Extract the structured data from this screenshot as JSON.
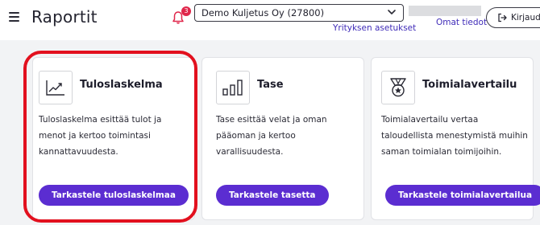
{
  "header": {
    "title": "Raportit",
    "notification_count": "3",
    "company_select_value": "Demo Kuljetus Oy (27800)",
    "company_settings_link": "Yrityksen asetukset",
    "own_info_link": "Omat tiedot",
    "logout_label": "Kirjaudu"
  },
  "cards": [
    {
      "title": "Tuloslaskelma",
      "description": "Tuloslaskelma esittää tulot ja menot ja kertoo toimintasi kannattavuudesta.",
      "button": "Tarkastele tuloslaskelmaa",
      "icon": "line-chart-icon"
    },
    {
      "title": "Tase",
      "description": "Tase esittää velat ja oman pääoman ja kertoo varallisuudesta.",
      "button": "Tarkastele tasetta",
      "icon": "bar-chart-icon"
    },
    {
      "title": "Toimialavertailu",
      "description": "Toimialavertailu vertaa taloudellista menestymistä muihin saman toimialan toimijoihin.",
      "button": "Tarkastele toimialavertailua",
      "icon": "medal-icon"
    }
  ],
  "colors": {
    "accent": "#5b2dd1",
    "link": "#3f2bb8",
    "badge": "#e0274b",
    "highlight": "#e2101e",
    "background": "#f2f3f5"
  }
}
